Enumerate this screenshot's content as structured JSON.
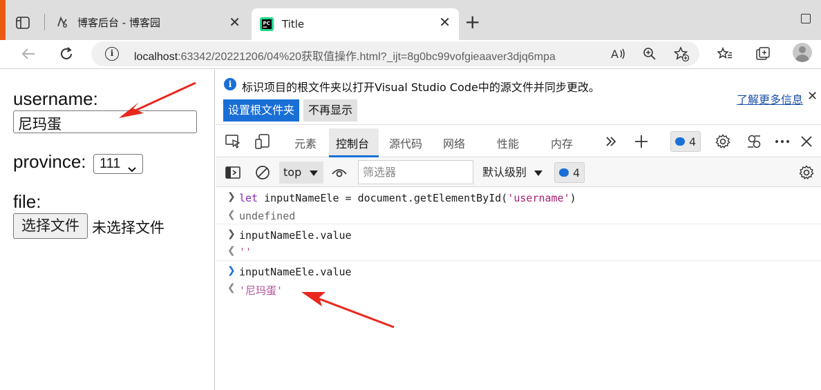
{
  "browser": {
    "tabs": [
      {
        "title": "博客后台 - 博客园",
        "close": "✕"
      },
      {
        "title": "Title",
        "close": "✕"
      }
    ],
    "new_tab": "+",
    "url_host": "localhost",
    "url_rest": ":63342/20221206/04%20获取值操作.html?_ijt=8g0bc99vofgieaaver3djq6mpa"
  },
  "page": {
    "username_label": "username:",
    "username_value": "尼玛蛋",
    "province_label": "province:",
    "province_value": "111",
    "file_label": "file:",
    "file_button": "选择文件",
    "file_status": "未选择文件"
  },
  "devtools": {
    "infobar": {
      "message": "标识项目的根文件夹以打开Visual Studio Code中的源文件并同步更改。",
      "primary_button": "设置根文件夹",
      "secondary_button": "不再显示",
      "learn_more": "了解更多信息",
      "close": "✕"
    },
    "tabs": [
      "元素",
      "控制台",
      "源代码",
      "网络",
      "性能",
      "内存"
    ],
    "active_tab": "控制台",
    "issues_count": "4",
    "console_bar": {
      "context": "top",
      "filter_placeholder": "筛选器",
      "level": "默认级别",
      "issues_count": "4"
    },
    "console": [
      {
        "type": "input",
        "text_pre": "let",
        "text_mid": " inputNameEle = document.getElementById(",
        "text_str": "'username'",
        "text_post": ")"
      },
      {
        "type": "output",
        "text": "undefined"
      },
      {
        "type": "input",
        "text": "inputNameEle.value"
      },
      {
        "type": "output",
        "text": "''"
      },
      {
        "type": "input",
        "text": "inputNameEle.value"
      },
      {
        "type": "output",
        "text": "'尼玛蛋'"
      }
    ]
  },
  "colors": {
    "accent_blue": "#1a6fd6",
    "annotation_red": "#e8281e",
    "string_pink": "#b2509b"
  }
}
